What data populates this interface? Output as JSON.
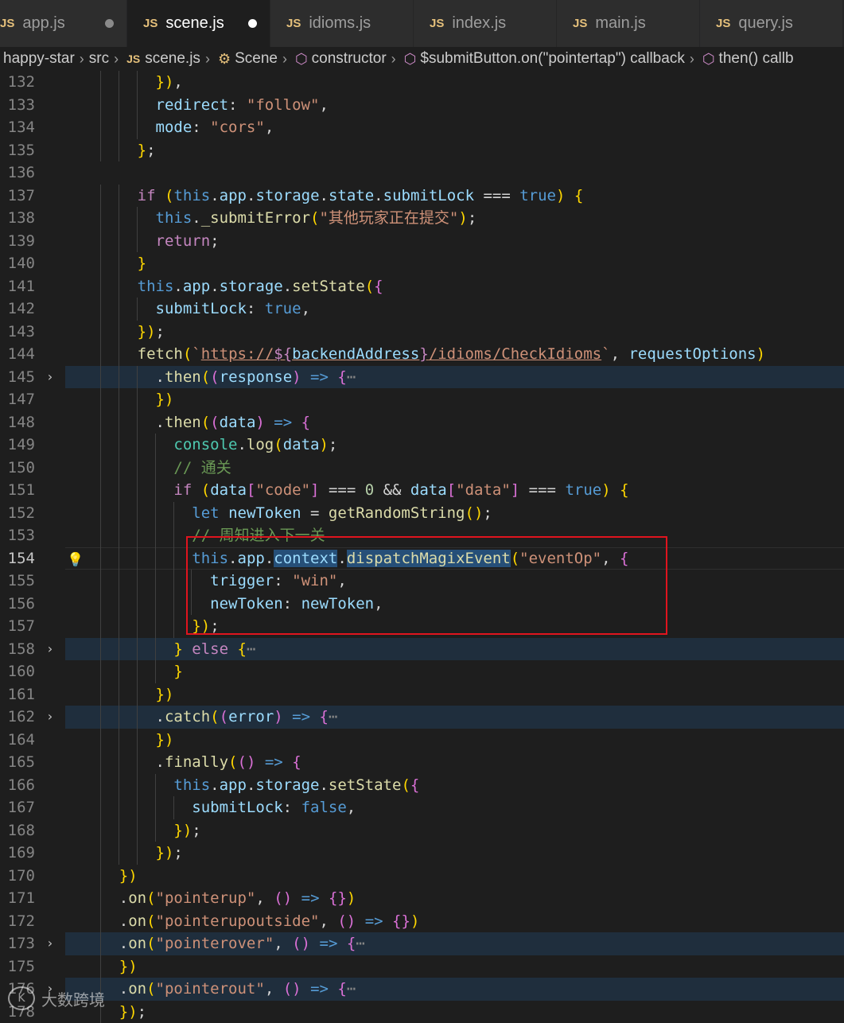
{
  "tabs": [
    {
      "icon": "JS",
      "label": "app.js",
      "dirty": true,
      "active": false
    },
    {
      "icon": "JS",
      "label": "scene.js",
      "dirty": true,
      "active": true
    },
    {
      "icon": "JS",
      "label": "idioms.js",
      "dirty": false,
      "active": false
    },
    {
      "icon": "JS",
      "label": "index.js",
      "dirty": false,
      "active": false
    },
    {
      "icon": "JS",
      "label": "main.js",
      "dirty": false,
      "active": false
    },
    {
      "icon": "JS",
      "label": "query.js",
      "dirty": false,
      "active": false
    }
  ],
  "breadcrumb": {
    "project": "happy-star",
    "folder": "src",
    "file_icon": "JS",
    "file": "scene.js",
    "class_name": "Scene",
    "method": "constructor",
    "callback": "$submitButton.on(\"pointertap\") callback",
    "then_callback": "then() callb"
  },
  "editor": {
    "current_line": "154",
    "lines": [
      {
        "n": "132",
        "indent": 4,
        "code": "}),"
      },
      {
        "n": "133",
        "indent": 4,
        "code": "redirect: \"follow\","
      },
      {
        "n": "134",
        "indent": 4,
        "code": "mode: \"cors\","
      },
      {
        "n": "135",
        "indent": 3,
        "code": "};"
      },
      {
        "n": "136",
        "indent": 0,
        "code": ""
      },
      {
        "n": "137",
        "indent": 3,
        "code": "if (this.app.storage.state.submitLock === true) {"
      },
      {
        "n": "138",
        "indent": 4,
        "code": "this._submitError(\"其他玩家正在提交\");"
      },
      {
        "n": "139",
        "indent": 4,
        "code": "return;"
      },
      {
        "n": "140",
        "indent": 3,
        "code": "}"
      },
      {
        "n": "141",
        "indent": 3,
        "code": "this.app.storage.setState({"
      },
      {
        "n": "142",
        "indent": 4,
        "code": "submitLock: true,"
      },
      {
        "n": "143",
        "indent": 3,
        "code": "});"
      },
      {
        "n": "144",
        "indent": 3,
        "code": "fetch(`https://${backendAddress}/idioms/CheckIdioms`, requestOptions)"
      },
      {
        "n": "145",
        "indent": 4,
        "code": ".then((response) => {⋯",
        "folded": true
      },
      {
        "n": "147",
        "indent": 4,
        "code": "})"
      },
      {
        "n": "148",
        "indent": 4,
        "code": ".then((data) => {"
      },
      {
        "n": "149",
        "indent": 5,
        "code": "console.log(data);"
      },
      {
        "n": "150",
        "indent": 5,
        "code": "// 通关"
      },
      {
        "n": "151",
        "indent": 5,
        "code": "if (data[\"code\"] === 0 && data[\"data\"] === true) {"
      },
      {
        "n": "152",
        "indent": 6,
        "code": "let newToken = getRandomString();"
      },
      {
        "n": "153",
        "indent": 6,
        "code": "// 周知进入下一关"
      },
      {
        "n": "154",
        "indent": 6,
        "code": "this.app.context.dispatchMagixEvent(\"eventOp\", {",
        "lightbulb": true
      },
      {
        "n": "155",
        "indent": 7,
        "code": "trigger: \"win\","
      },
      {
        "n": "156",
        "indent": 7,
        "code": "newToken: newToken,"
      },
      {
        "n": "157",
        "indent": 6,
        "code": "});"
      },
      {
        "n": "158",
        "indent": 5,
        "code": "} else {⋯",
        "folded": true
      },
      {
        "n": "160",
        "indent": 5,
        "code": "}"
      },
      {
        "n": "161",
        "indent": 4,
        "code": "})"
      },
      {
        "n": "162",
        "indent": 4,
        "code": ".catch((error) => {⋯",
        "folded": true
      },
      {
        "n": "164",
        "indent": 4,
        "code": "})"
      },
      {
        "n": "165",
        "indent": 4,
        "code": ".finally(() => {"
      },
      {
        "n": "166",
        "indent": 5,
        "code": "this.app.storage.setState({"
      },
      {
        "n": "167",
        "indent": 6,
        "code": "submitLock: false,"
      },
      {
        "n": "168",
        "indent": 5,
        "code": "});"
      },
      {
        "n": "169",
        "indent": 4,
        "code": "});"
      },
      {
        "n": "170",
        "indent": 2,
        "code": "})"
      },
      {
        "n": "171",
        "indent": 2,
        "code": ".on(\"pointerup\", () => {})"
      },
      {
        "n": "172",
        "indent": 2,
        "code": ".on(\"pointerupoutside\", () => {})"
      },
      {
        "n": "173",
        "indent": 2,
        "code": ".on(\"pointerover\", () => {⋯",
        "folded": true
      },
      {
        "n": "175",
        "indent": 2,
        "code": "})"
      },
      {
        "n": "176",
        "indent": 2,
        "code": ".on(\"pointerout\", () => {⋯",
        "folded": true
      },
      {
        "n": "178",
        "indent": 2,
        "code": "});"
      }
    ]
  },
  "watermark": "大数跨境",
  "colors": {
    "keyword": "#569cd6",
    "string": "#ce9178",
    "property": "#9cdcfe",
    "function": "#dcdcaa",
    "comment": "#6a9955",
    "highlight_box": "#e0141e"
  }
}
